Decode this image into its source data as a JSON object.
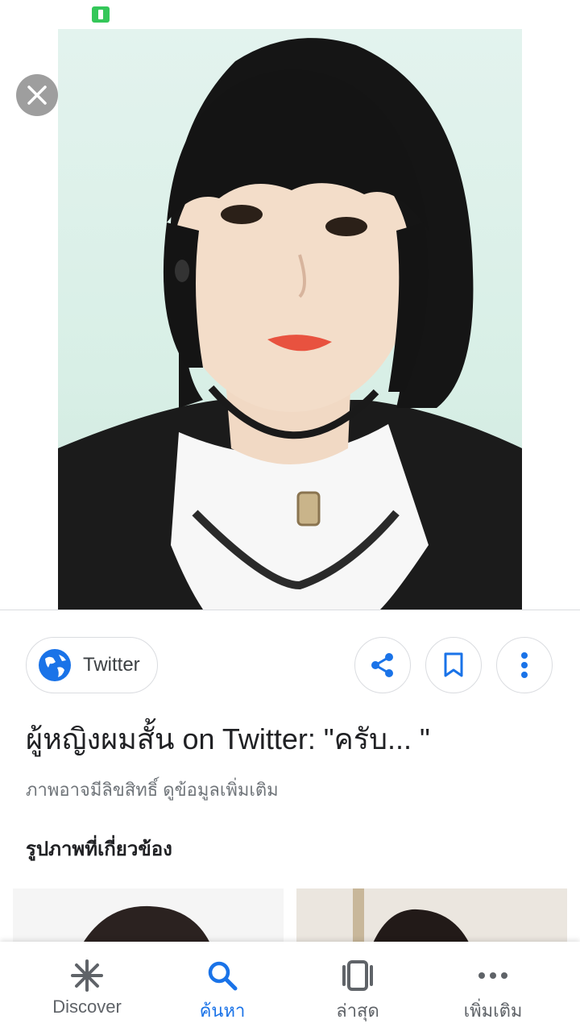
{
  "result": {
    "source_label": "Twitter",
    "title": "ผู้หญิงผมสั้น on Twitter: \"ครับ... \"",
    "subtitle": "ภาพอาจมีลิขสิทธิ์ ดูข้อมูลเพิ่มเติม",
    "related_heading": "รูปภาพที่เกี่ยวข้อง"
  },
  "bottom_nav": {
    "items": [
      {
        "label": "Discover",
        "icon": "asterisk-icon"
      },
      {
        "label": "ค้นหา",
        "icon": "search-icon",
        "active": true
      },
      {
        "label": "ล่าสุด",
        "icon": "recent-tabs-icon"
      },
      {
        "label": "เพิ่มเติม",
        "icon": "more-horizontal-icon"
      }
    ]
  },
  "colors": {
    "accent": "#1a73e8",
    "battery": "#34c759",
    "close_button_bg": "#9e9e9e"
  }
}
